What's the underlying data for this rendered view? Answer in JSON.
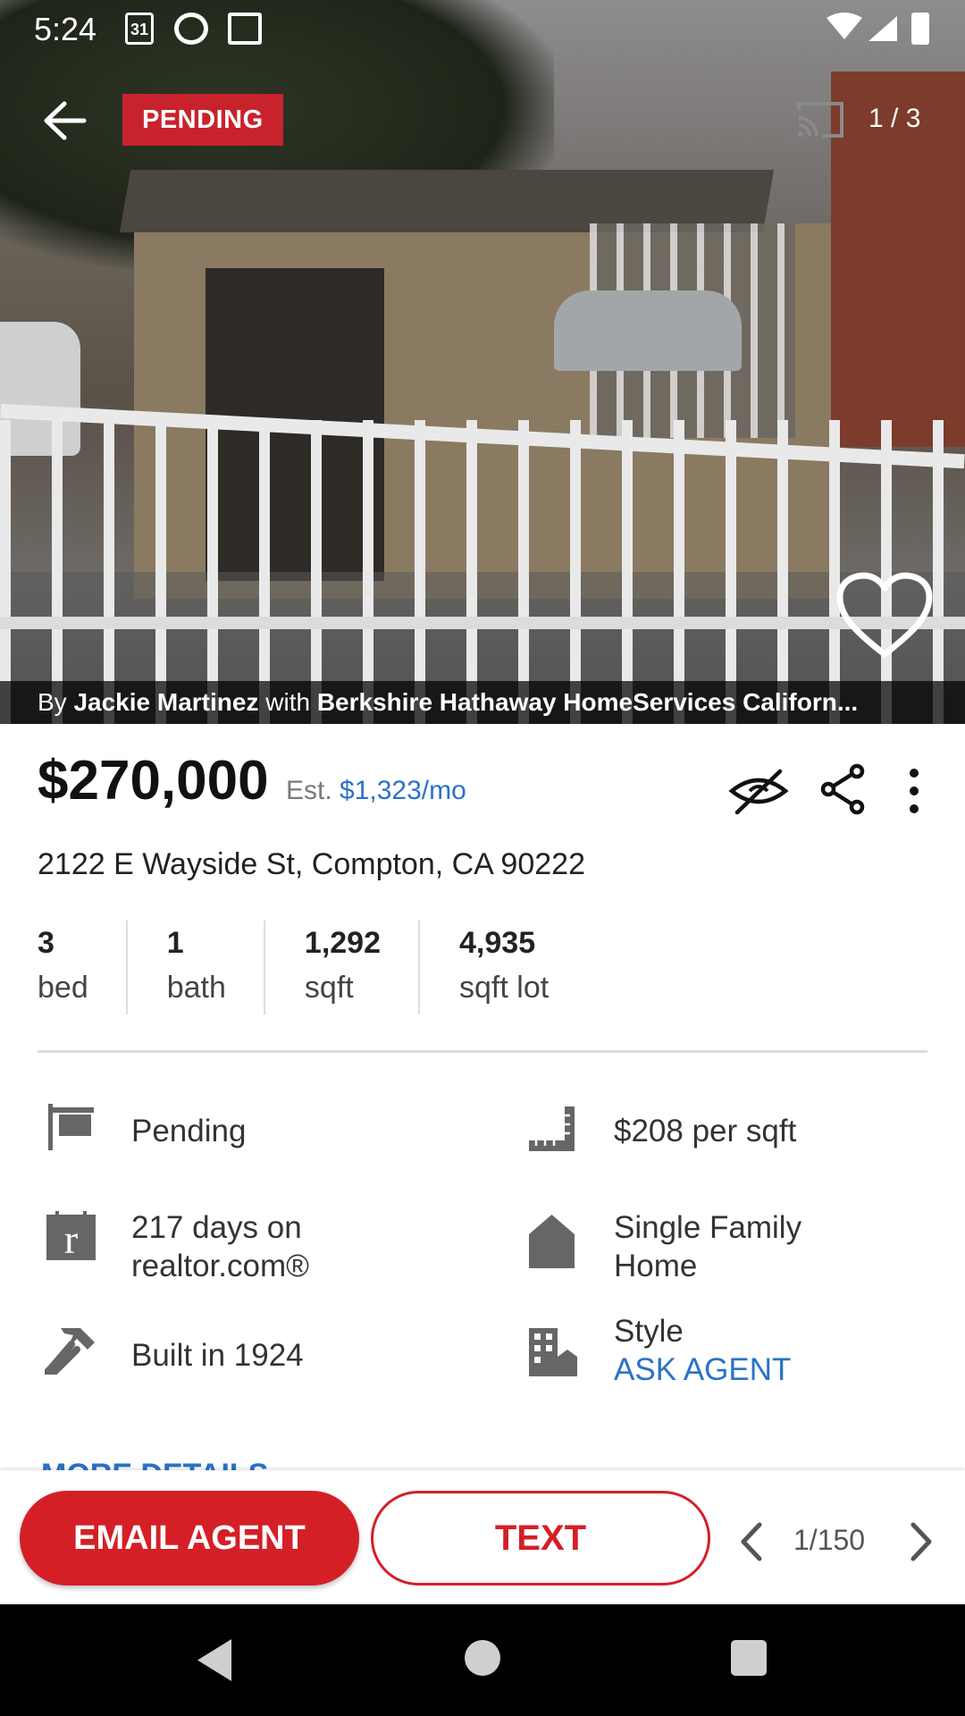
{
  "status_bar": {
    "time": "5:24",
    "calendar_day": "31"
  },
  "photo": {
    "badge": "PENDING",
    "counter": "1 / 3",
    "credit": {
      "by": "By",
      "agent": "Jackie Martinez",
      "with": "with",
      "brokerage": "Berkshire Hathaway HomeServices Californ..."
    }
  },
  "listing": {
    "price": "$270,000",
    "est_label": "Est.",
    "est_monthly": "$1,323/mo",
    "address": "2122 E Wayside St, Compton, CA 90222",
    "stats": [
      {
        "value": "3",
        "label": "bed"
      },
      {
        "value": "1",
        "label": "bath"
      },
      {
        "value": "1,292",
        "label": "sqft"
      },
      {
        "value": "4,935",
        "label": "sqft lot"
      }
    ]
  },
  "details": {
    "status": "Pending",
    "price_per_sqft": "$208 per sqft",
    "days_on_market_line1": "217 days on",
    "days_on_market_line2": "realtor.com®",
    "property_type_line1": "Single Family",
    "property_type_line2": "Home",
    "built": "Built in 1924",
    "style_label": "Style",
    "style_value": "ASK AGENT",
    "more_details": "MORE DETAILS"
  },
  "actions": {
    "email": "EMAIL AGENT",
    "text": "TEXT",
    "pager": "1/150"
  },
  "colors": {
    "accent_red": "#d51f27",
    "link_blue": "#2a72c9",
    "badge_red": "#c8232c"
  },
  "icons": [
    "back-arrow-icon",
    "cast-icon",
    "heart-icon",
    "hide-icon",
    "share-icon",
    "more-vert-icon",
    "sign-icon",
    "ruler-icon",
    "realtor-r-icon",
    "house-icon",
    "hammer-icon",
    "building-icon",
    "chevron-left-icon",
    "chevron-right-icon"
  ]
}
